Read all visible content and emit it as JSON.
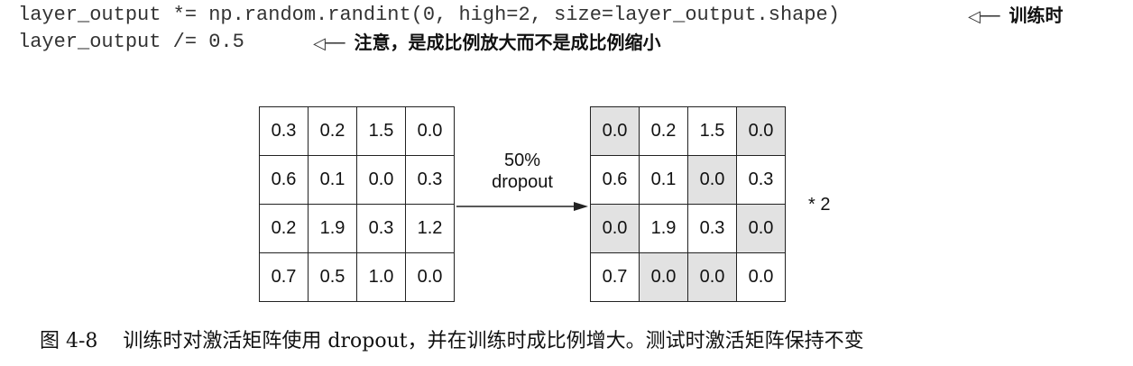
{
  "code": {
    "line1": "layer_output *= np.random.randint(0, high=2, size=layer_output.shape)",
    "line2": "layer_output /= 0.5"
  },
  "annotations": {
    "train_label": "训练时",
    "scale_note": "注意，是成比例放大而不是成比例缩小"
  },
  "input_matrix": [
    [
      "0.3",
      "0.2",
      "1.5",
      "0.0"
    ],
    [
      "0.6",
      "0.1",
      "0.0",
      "0.3"
    ],
    [
      "0.2",
      "1.9",
      "0.3",
      "1.2"
    ],
    [
      "0.7",
      "0.5",
      "1.0",
      "0.0"
    ]
  ],
  "output_matrix": [
    [
      "0.0",
      "0.2",
      "1.5",
      "0.0"
    ],
    [
      "0.6",
      "0.1",
      "0.0",
      "0.3"
    ],
    [
      "0.0",
      "1.9",
      "0.3",
      "0.0"
    ],
    [
      "0.7",
      "0.0",
      "0.0",
      "0.0"
    ]
  ],
  "dropped_mask": [
    [
      true,
      false,
      false,
      true
    ],
    [
      false,
      false,
      true,
      false
    ],
    [
      true,
      false,
      false,
      true
    ],
    [
      false,
      true,
      true,
      false
    ]
  ],
  "dropout_label": {
    "rate": "50%",
    "name": "dropout"
  },
  "scale_label": "* 2",
  "caption": {
    "figure_number": "图 4-8",
    "text": "训练时对激活矩阵使用 dropout，并在训练时成比例增大。测试时激活矩阵保持不变"
  },
  "colors": {
    "dropped_cell": "#e2e2e2",
    "border": "#222222"
  }
}
